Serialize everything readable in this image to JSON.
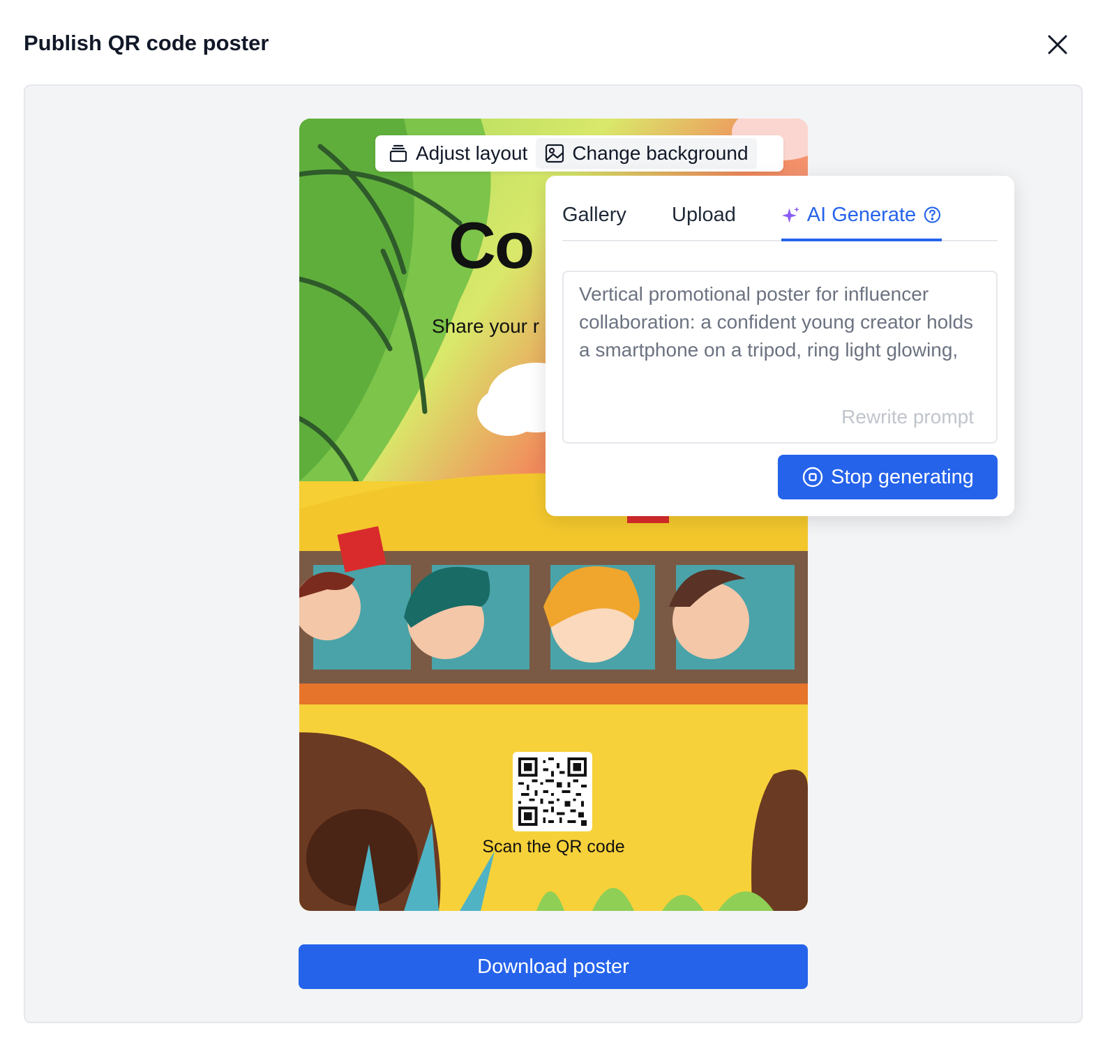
{
  "dialog": {
    "title": "Publish QR code poster",
    "close_icon": "close-icon"
  },
  "toolbar": {
    "adjust_layout_label": "Adjust layout",
    "adjust_layout_icon": "layers-icon",
    "change_background_label": "Change background",
    "change_background_icon": "image-icon"
  },
  "poster": {
    "title": "Co",
    "subtitle": "Share your r",
    "qr_caption": "Scan the QR code"
  },
  "background_panel": {
    "tabs": [
      {
        "label": "Gallery",
        "active": false
      },
      {
        "label": "Upload",
        "active": false
      },
      {
        "label": "AI Generate",
        "active": true,
        "icon": "sparkle-icon",
        "help_icon": "help-circle-icon"
      }
    ],
    "prompt": "Vertical promotional poster for influencer collaboration: a confident young creator holds a smartphone on a tripod, ring light glowing,",
    "rewrite_label": "Rewrite prompt",
    "stop_label": "Stop generating",
    "stop_icon": "stop-circle-icon"
  },
  "footer": {
    "download_label": "Download poster"
  },
  "colors": {
    "primary": "#2563eb",
    "canvas_bg": "#f3f4f6",
    "ai_sparkle": "#8b5cf6"
  }
}
